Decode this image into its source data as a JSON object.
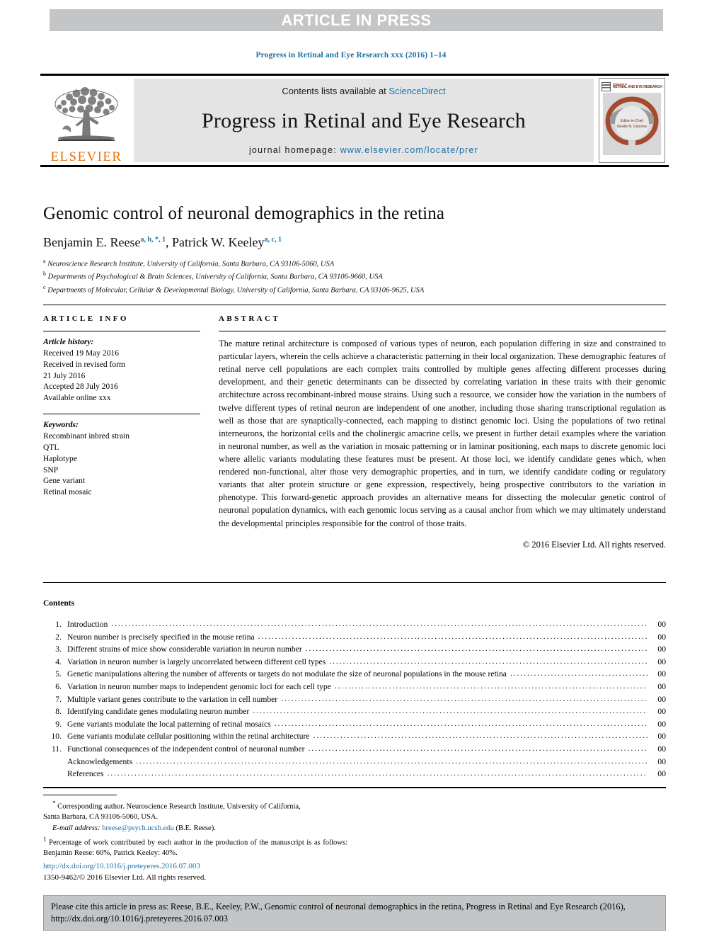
{
  "banner": {
    "text": "ARTICLE IN PRESS"
  },
  "running_head": "Progress in Retinal and Eye Research xxx (2016) 1–14",
  "masthead": {
    "publisher": "ELSEVIER",
    "contents_prefix": "Contents lists available at ",
    "contents_link": "ScienceDirect",
    "journal_title": "Progress in Retinal and Eye Research",
    "homepage_prefix": "journal homepage: ",
    "homepage_link": "www.elsevier.com/locate/prer",
    "cover_title": "RETINAL AND EYE RESEARCH",
    "cover_sub1": "Progress in",
    "cover_inner1": "Editor-in-Chief",
    "cover_inner2": "Neville N. Osborne"
  },
  "article": {
    "title": "Genomic control of neuronal demographics in the retina",
    "authors": [
      {
        "name": "Benjamin E. Reese",
        "sup": "a, b, *, 1"
      },
      {
        "name": "Patrick W. Keeley",
        "sup": "a, c, 1"
      }
    ],
    "affiliations": [
      {
        "mark": "a",
        "text": "Neuroscience Research Institute, University of California, Santa Barbara, CA 93106-5060, USA"
      },
      {
        "mark": "b",
        "text": "Departments of Psychological & Brain Sciences, University of California, Santa Barbara, CA 93106-9660, USA"
      },
      {
        "mark": "c",
        "text": "Departments of Molecular, Cellular & Developmental Biology, University of California, Santa Barbara, CA 93106-9625, USA"
      }
    ]
  },
  "info": {
    "heading": "ARTICLE INFO",
    "history_label": "Article history:",
    "history_lines": [
      "Received 19 May 2016",
      "Received in revised form",
      "21 July 2016",
      "Accepted 28 July 2016",
      "Available online xxx"
    ],
    "keywords_label": "Keywords:",
    "keywords": [
      "Recombinant inbred strain",
      "QTL",
      "Haplotype",
      "SNP",
      "Gene variant",
      "Retinal mosaic"
    ]
  },
  "abstract": {
    "heading": "ABSTRACT",
    "body": "The mature retinal architecture is composed of various types of neuron, each population differing in size and constrained to particular layers, wherein the cells achieve a characteristic patterning in their local organization. These demographic features of retinal nerve cell populations are each complex traits controlled by multiple genes affecting different processes during development, and their genetic determinants can be dissected by correlating variation in these traits with their genomic architecture across recombinant-inbred mouse strains. Using such a resource, we consider how the variation in the numbers of twelve different types of retinal neuron are independent of one another, including those sharing transcriptional regulation as well as those that are synaptically-connected, each mapping to distinct genomic loci. Using the populations of two retinal interneurons, the horizontal cells and the cholinergic amacrine cells, we present in further detail examples where the variation in neuronal number, as well as the variation in mosaic patterning or in laminar positioning, each maps to discrete genomic loci where allelic variants modulating these features must be present. At those loci, we identify candidate genes which, when rendered non-functional, alter those very demographic properties, and in turn, we identify candidate coding or regulatory variants that alter protein structure or gene expression, respectively, being prospective contributors to the variation in phenotype. This forward-genetic approach provides an alternative means for dissecting the molecular genetic control of neuronal population dynamics, with each genomic locus serving as a causal anchor from which we may ultimately understand the developmental principles responsible for the control of those traits.",
    "copyright": "© 2016 Elsevier Ltd. All rights reserved."
  },
  "contents": {
    "heading": "Contents",
    "items": [
      {
        "num": "1.",
        "label": "Introduction",
        "page": "00"
      },
      {
        "num": "2.",
        "label": "Neuron number is precisely specified in the mouse retina",
        "page": "00"
      },
      {
        "num": "3.",
        "label": "Different strains of mice show considerable variation in neuron number",
        "page": "00"
      },
      {
        "num": "4.",
        "label": "Variation in neuron number is largely uncorrelated between different cell types",
        "page": "00"
      },
      {
        "num": "5.",
        "label": "Genetic manipulations altering the number of afferents or targets do not modulate the size of neuronal populations in the mouse retina",
        "page": "00"
      },
      {
        "num": "6.",
        "label": "Variation in neuron number maps to independent genomic loci for each cell type",
        "page": "00"
      },
      {
        "num": "7.",
        "label": "Multiple variant genes contribute to the variation in cell number",
        "page": "00"
      },
      {
        "num": "8.",
        "label": "Identifying candidate genes modulating neuron number",
        "page": "00"
      },
      {
        "num": "9.",
        "label": "Gene variants modulate the local patterning of retinal mosaics",
        "page": "00"
      },
      {
        "num": "10.",
        "label": "Gene variants modulate cellular positioning within the retinal architecture",
        "page": "00"
      },
      {
        "num": "11.",
        "label": "Functional consequences of the independent control of neuronal number",
        "page": "00"
      },
      {
        "num": "",
        "label": "Acknowledgements",
        "page": "00"
      },
      {
        "num": "",
        "label": "References",
        "page": "00"
      }
    ]
  },
  "footnotes": {
    "corresponding_mark": "*",
    "corresponding_line1": "Corresponding author. Neuroscience Research Institute, University of California,",
    "corresponding_line2": "Santa Barbara, CA 93106-5060, USA.",
    "email_label": "E-mail address:",
    "email": "breese@psych.ucsb.edu",
    "email_suffix": "(B.E. Reese).",
    "note_mark": "1",
    "note_text": "Percentage of work contributed by each author in the production of the manuscript is as follows: Benjamin Reese: 60%, Patrick Keeley: 40%."
  },
  "doi": {
    "url": "http://dx.doi.org/10.1016/j.preteyeres.2016.07.003",
    "issn_line": "1350-9462/© 2016 Elsevier Ltd. All rights reserved."
  },
  "citation_footer": {
    "text": "Please cite this article in press as: Reese, B.E., Keeley, P.W., Genomic control of neuronal demographics in the retina, Progress in Retinal and Eye Research (2016), http://dx.doi.org/10.1016/j.preteyeres.2016.07.003"
  },
  "colors": {
    "banner_bg": "#c3c5c7",
    "link_blue": "#1a6fa8",
    "masthead_grey": "#e4e4e4",
    "elsevier_orange": "#e8700a",
    "cover_rust": "#a44a2e"
  }
}
